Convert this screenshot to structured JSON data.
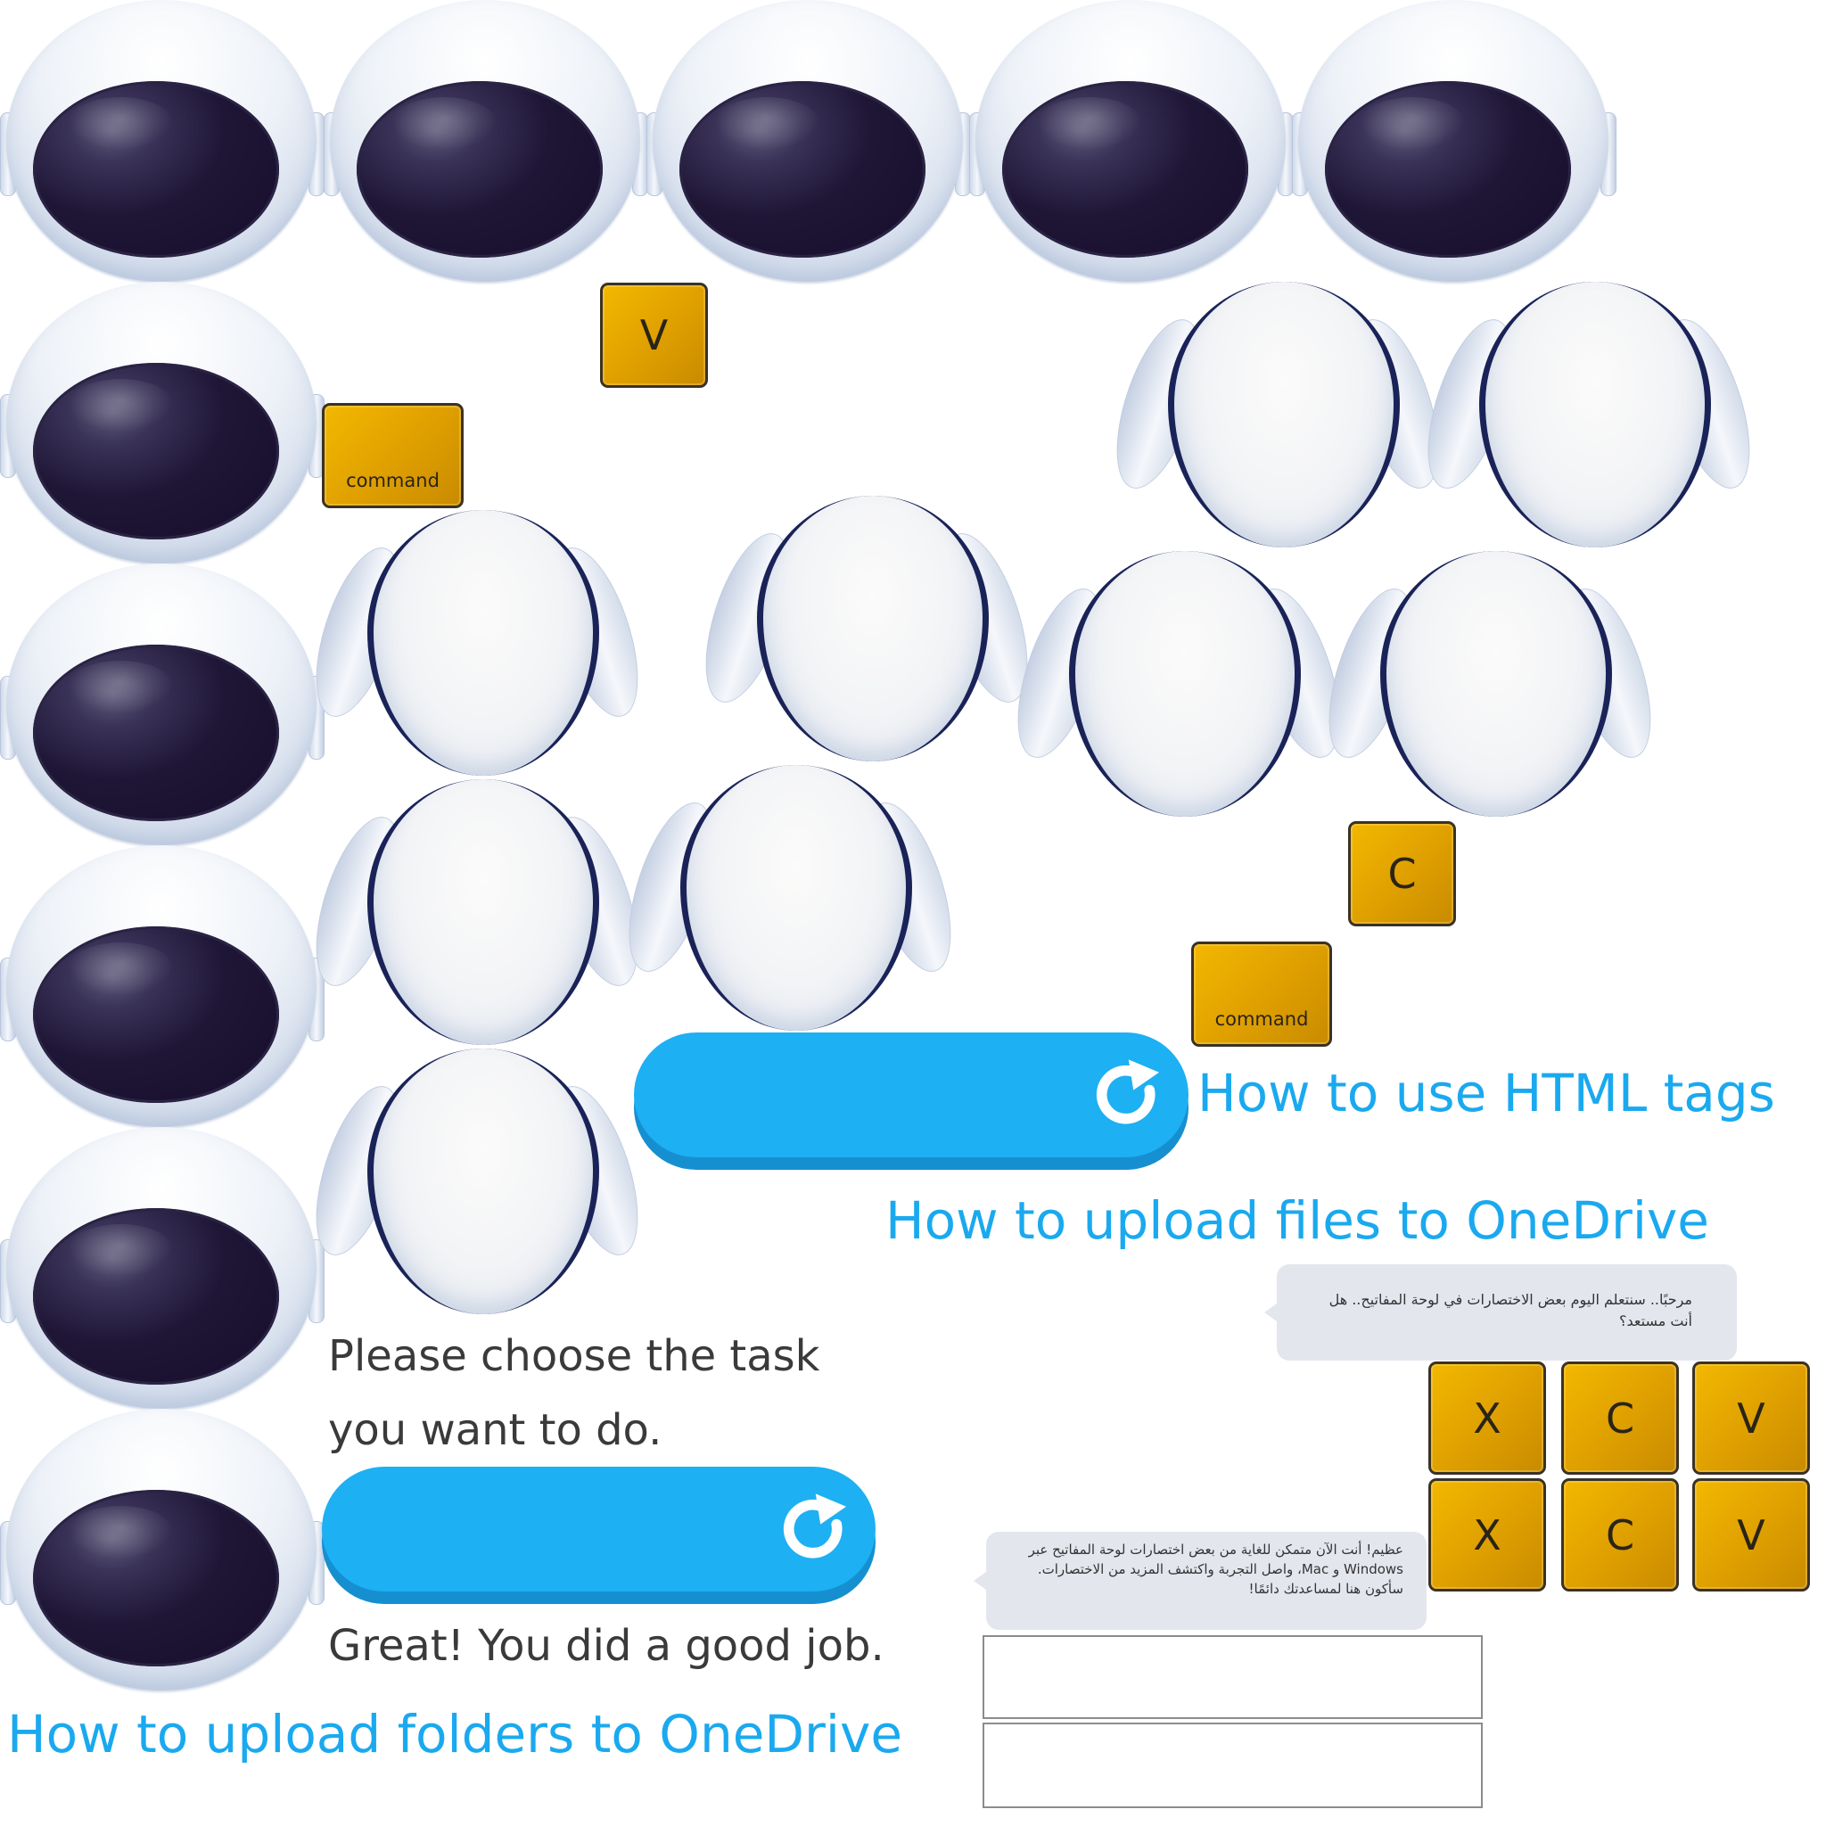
{
  "colors": {
    "accent_blue": "#1db0f3",
    "accent_blue_shadow": "#168fd0",
    "key_gold": "#e0a100",
    "visor": "#1f1636",
    "text_dark": "#3a3a3a",
    "bubble_bg": "#e4e6ee"
  },
  "icons": {
    "restart": "restart-icon",
    "helmet": "robot-helmet-icon",
    "robot_back": "robot-head-back-icon"
  },
  "keys": {
    "v_top": "V",
    "command_left": "command",
    "c_right": "C",
    "command_right": "command",
    "grid_row1": [
      "X",
      "C",
      "V"
    ],
    "grid_row2": [
      "X",
      "C",
      "V"
    ]
  },
  "labels": {
    "html_tags": "How to use HTML tags",
    "upload_files": "How to upload files to OneDrive",
    "choose_task_line1": "Please choose the task",
    "choose_task_line2": "you want to do.",
    "great_job": "Great! You did a good job.",
    "upload_folders": "How to upload folders to OneDrive"
  },
  "bubbles": {
    "welcome": "مرحبًا.. سنتعلم اليوم بعض الاختصارات في لوحة المفاتيح.. هل أنت مستعد؟",
    "finish": "عظيم! أنت الآن متمكن للغاية من بعض اختصارات لوحة المفاتيح عبر Windows و Mac، واصل التجربة واكتشف المزيد من الاختصارات. سأكون هنا لمساعدتك دائمًا!"
  }
}
